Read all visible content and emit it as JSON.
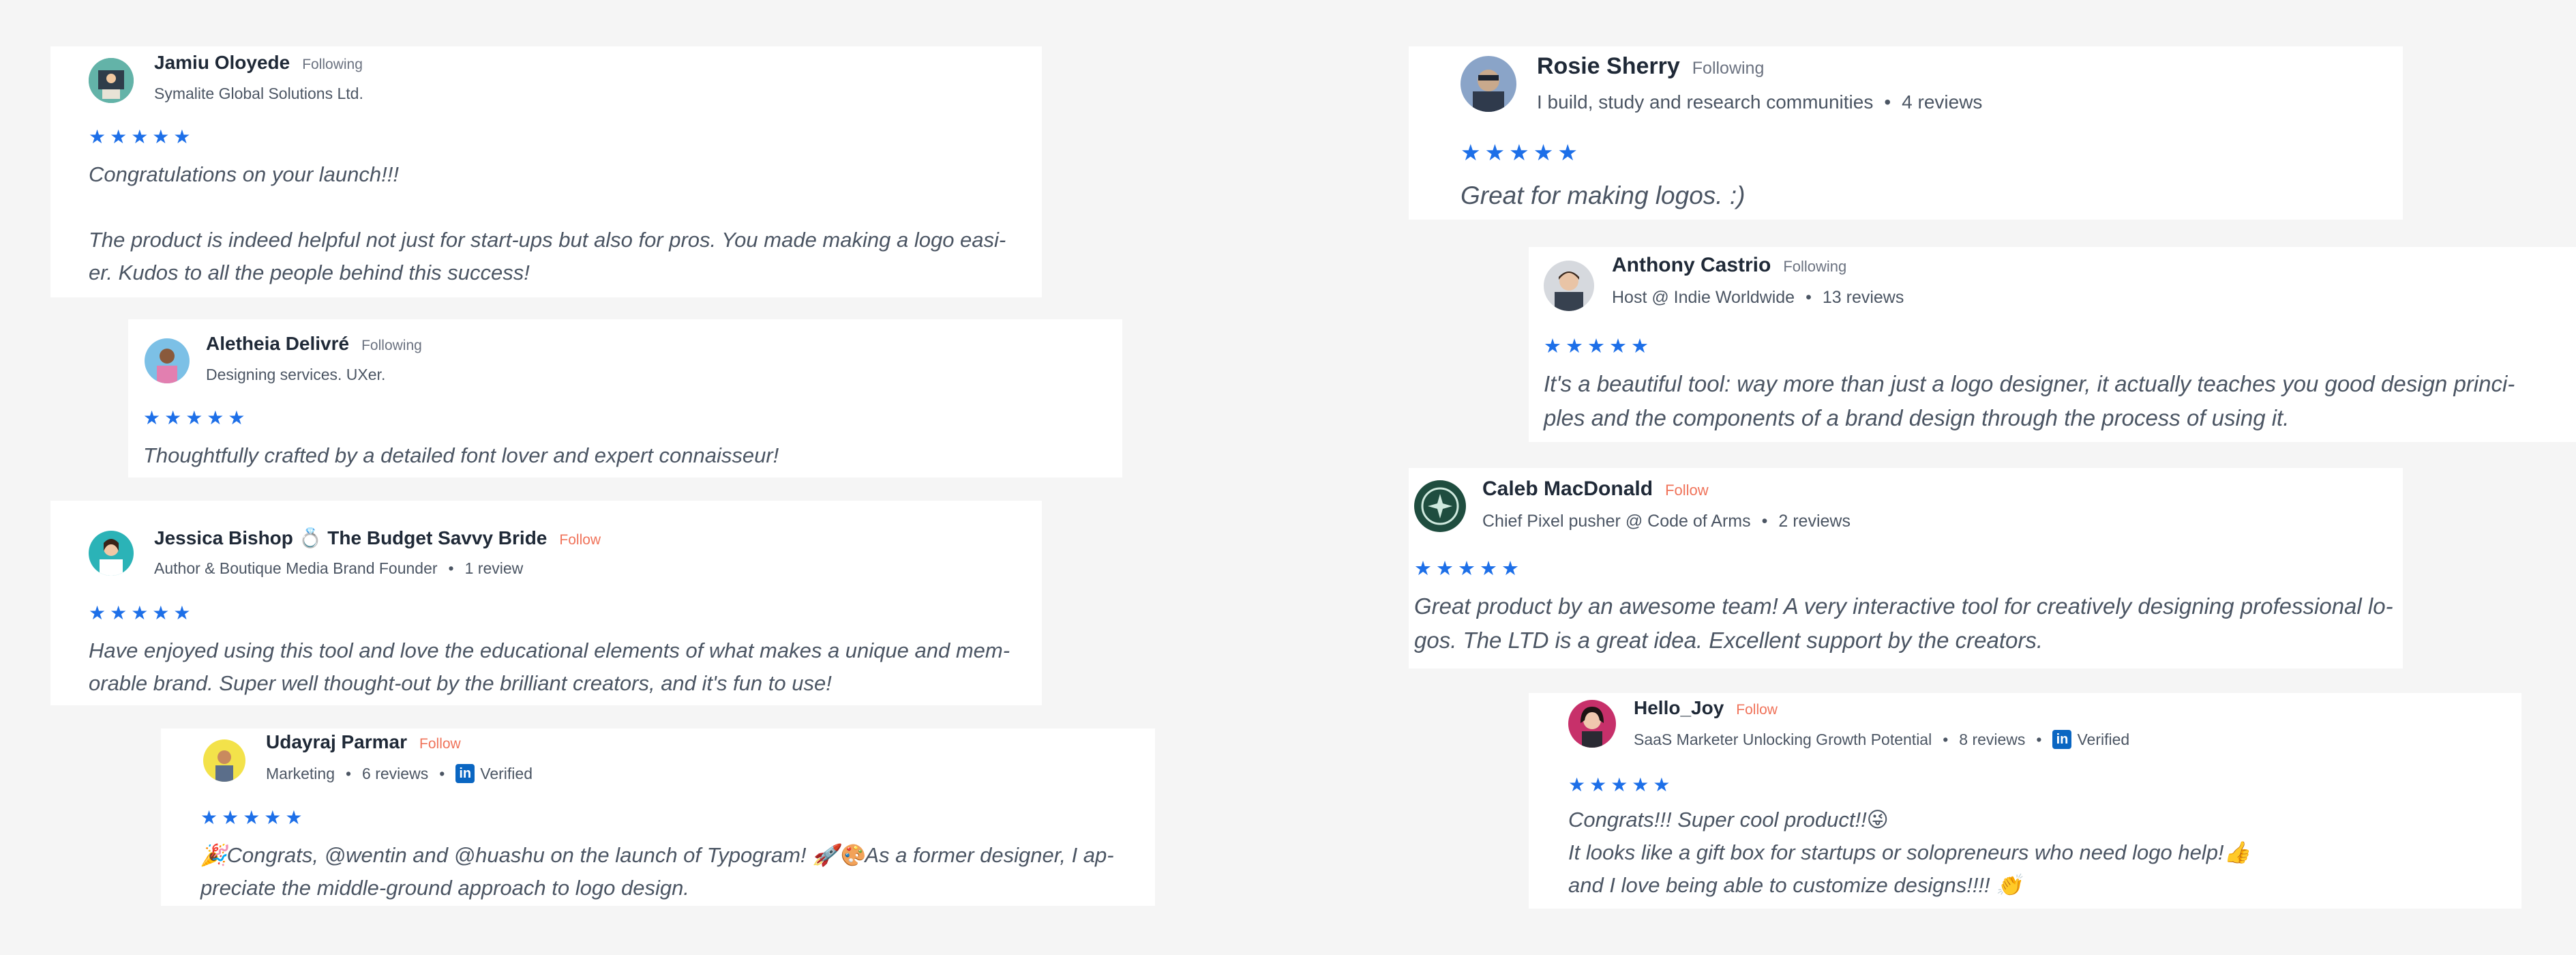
{
  "reviews": [
    {
      "name": "Jamiu Oloyede",
      "tag": "Following",
      "meta": "Symalite Global Solutions Ltd.",
      "stars": "★★★★★",
      "body": "Congratulations on your launch!!!\n\nThe product is indeed helpful not just for start-ups but also for pros. You made making a logo easi-\ner. Kudos to all the people behind this success!"
    },
    {
      "name": "Aletheia Delivré",
      "tag": "Following",
      "meta": "Designing services. UXer.",
      "stars": "★★★★★",
      "body": "Thoughtfully crafted by a detailed font lover and expert connaisseur!"
    },
    {
      "name": "Jessica Bishop 💍 The Budget Savvy Bride",
      "tag": "Follow",
      "meta": "Author & Boutique Media Brand Founder",
      "reviews": "1 review",
      "stars": "★★★★★",
      "body": "Have enjoyed using this tool and love the educational elements of what makes a unique and mem-\norable brand. Super well thought-out by the brilliant creators, and it's fun to use!"
    },
    {
      "name": "Udayraj Parmar",
      "tag": "Follow",
      "meta": "Marketing",
      "reviews": "6 reviews",
      "verified": "Verified",
      "stars": "★★★★★",
      "body": "🎉Congrats, @wentin and @huashu on the launch of Typogram! 🚀🎨As a former designer, I ap-\npreciate the middle-ground approach to logo design."
    },
    {
      "name": "Rosie Sherry",
      "tag": "Following",
      "meta": "I build, study and research communities",
      "reviews": "4 reviews",
      "stars": "★★★★★",
      "body": "Great for making logos. :)"
    },
    {
      "name": "Anthony Castrio",
      "tag": "Following",
      "meta": "Host @ Indie Worldwide",
      "reviews": "13 reviews",
      "stars": "★★★★★",
      "body": "It's a beautiful tool: way more than just a logo designer, it actually teaches you good design princi-\nples and the components of a brand design through the process of using it."
    },
    {
      "name": "Caleb MacDonald",
      "tag": "Follow",
      "meta": "Chief Pixel pusher @ Code of Arms",
      "reviews": "2 reviews",
      "stars": "★★★★★",
      "body": "Great product by an awesome team! A very interactive tool for creatively designing professional lo-\ngos. The LTD is a great idea. Excellent support by the creators."
    },
    {
      "name": "Hello_Joy",
      "tag": "Follow",
      "meta": "SaaS Marketer Unlocking Growth Potential",
      "reviews": "8 reviews",
      "verified": "Verified",
      "stars": "★★★★★",
      "body": "Congrats!!! Super cool product!!😜\nIt looks like a gift box for startups or solopreneurs who need logo help!👍\nand I love being able to customize designs!!!! 👏"
    }
  ],
  "linkedin_glyph": "in",
  "colors": {
    "star": "#1d6fe8",
    "follow": "#f0735a",
    "linkedin": "#0a66c2"
  }
}
